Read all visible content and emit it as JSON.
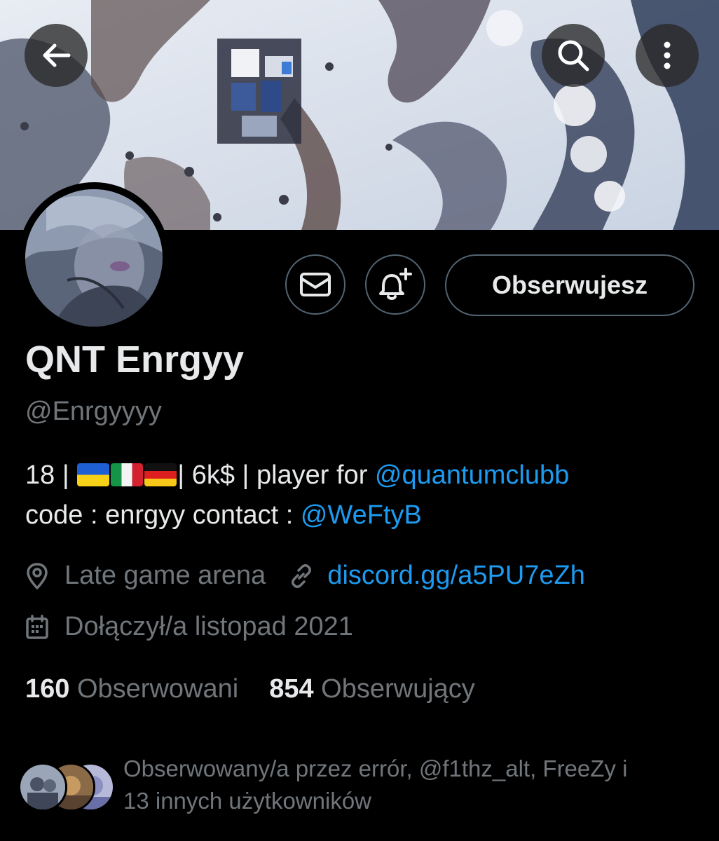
{
  "header": {
    "back_icon": "arrow-left-icon",
    "search_icon": "search-icon",
    "more_icon": "more-vertical-icon"
  },
  "actions": {
    "message_icon": "envelope-icon",
    "notify_icon": "bell-plus-icon",
    "follow_label": "Obserwujesz"
  },
  "profile": {
    "display_name": "QNT Enrgyy",
    "handle": "@Enrgyyyy",
    "bio": {
      "line1_prefix": "18 |",
      "flags": [
        "ukraine-flag",
        "italy-flag",
        "germany-flag"
      ],
      "line1_middle": "| 6k$ | player for",
      "line1_mention": "@quantumclubb",
      "line2_prefix": "code : enrgyy contact :",
      "line2_mention": "@WeFtyB"
    },
    "location": "Late game arena",
    "website": "discord.gg/a5PU7eZh",
    "joined": "Dołączył/a listopad 2021"
  },
  "stats": {
    "following_count": "160",
    "following_label": "Obserwowani",
    "followers_count": "854",
    "followers_label": "Obserwujący"
  },
  "followed_by": {
    "line1": "Obserwowany/a przez errór, @f1thz_alt, FreeZy i",
    "line2": "13 innych użytkowników"
  },
  "colors": {
    "background": "#000000",
    "text_primary": "#e7e9ea",
    "text_secondary": "#71767b",
    "link": "#1d9bf0",
    "button_border": "#536471"
  }
}
